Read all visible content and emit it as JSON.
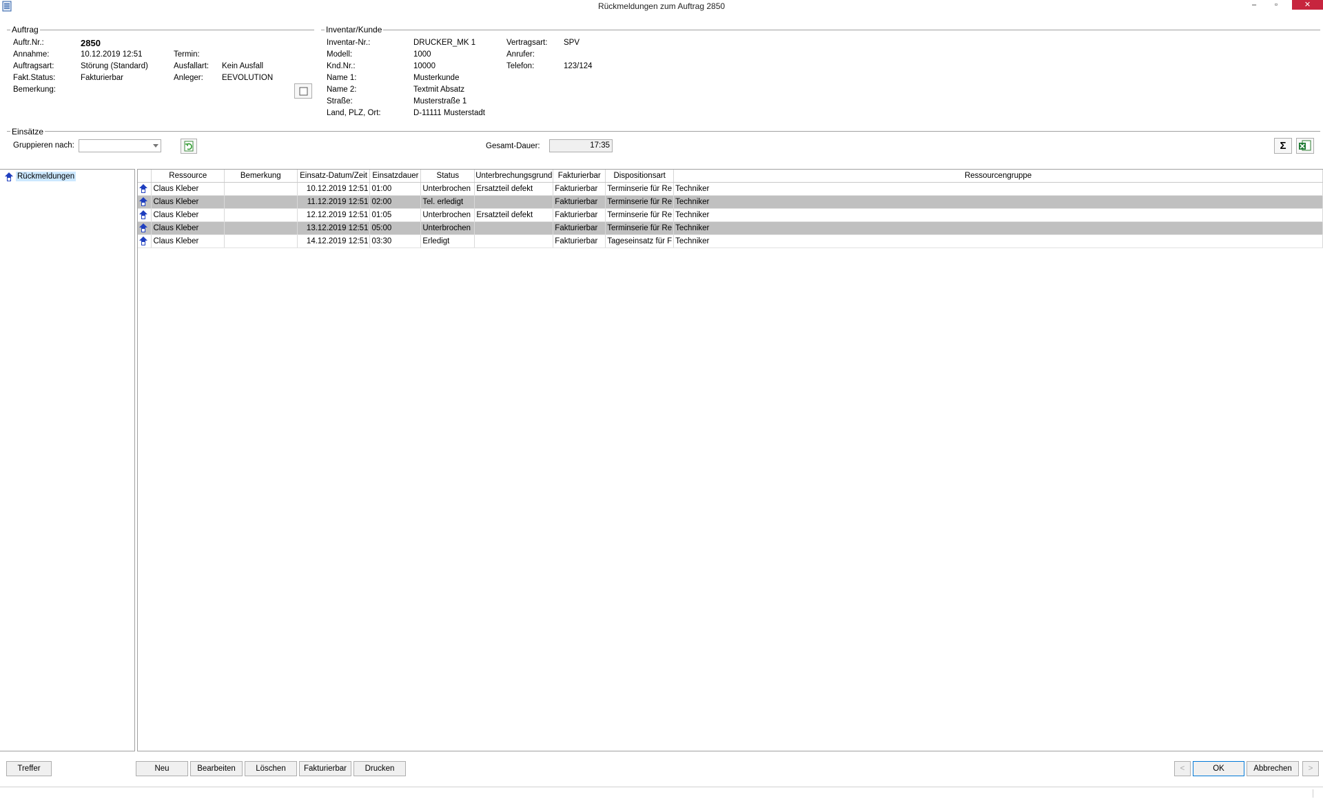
{
  "window": {
    "title": "Rückmeldungen zum Auftrag 2850",
    "min": "–",
    "max": "▫",
    "close": "✕"
  },
  "auftrag": {
    "title": "Auftrag",
    "auftr_nr_label": "Auftr.Nr.:",
    "auftr_nr": "2850",
    "annahme_label": "Annahme:",
    "annahme": "10.12.2019 12:51",
    "auftragsart_label": "Auftragsart:",
    "auftragsart": "Störung (Standard)",
    "fakt_status_label": "Fakt.Status:",
    "fakt_status": "Fakturierbar",
    "bemerkung_label": "Bemerkung:",
    "termin_label": "Termin:",
    "ausfallart_label": "Ausfallart:",
    "ausfallart": "Kein Ausfall",
    "anleger_label": "Anleger:",
    "anleger": "EEVOLUTION"
  },
  "inventar": {
    "title": "Inventar/Kunde",
    "inventar_nr_label": "Inventar-Nr.:",
    "inventar_nr": "DRUCKER_MK 1",
    "modell_label": "Modell:",
    "modell": "1000",
    "knd_nr_label": "Knd.Nr.:",
    "knd_nr": "10000",
    "name1_label": "Name 1:",
    "name1": "Musterkunde",
    "name2_label": "Name 2:",
    "name2": "Textmit Absatz",
    "strasse_label": "Straße:",
    "strasse": "Musterstraße 1",
    "land_label": "Land, PLZ, Ort:",
    "land": "D-11111 Musterstadt",
    "vertragsart_label": "Vertragsart:",
    "vertragsart": "SPV",
    "anrufer_label": "Anrufer:",
    "telefon_label": "Telefon:",
    "telefon": "123/124"
  },
  "einsaetze": {
    "title": "Einsätze",
    "gruppieren_label": "Gruppieren nach:",
    "gruppieren_value": "",
    "gesamt_label": "Gesamt-Dauer:",
    "gesamt_value": "17:35"
  },
  "tree": {
    "root": "Rückmeldungen"
  },
  "grid": {
    "columns": [
      "Ressource",
      "Bemerkung",
      "Einsatz-Datum/Zeit",
      "Einsatzdauer",
      "Status",
      "Unterbrechungsgrund",
      "Fakturierbar",
      "Dispositionsart",
      "Ressourcengruppe"
    ],
    "rows": [
      {
        "ressource": "Claus Kleber",
        "bemerkung": "",
        "datum": "10.12.2019 12:51",
        "dauer": "01:00",
        "status": "Unterbrochen",
        "grund": "Ersatzteil defekt",
        "fakt": "Fakturierbar",
        "dispo": "Terminserie für Re",
        "gruppe": "Techniker"
      },
      {
        "ressource": "Claus Kleber",
        "bemerkung": "",
        "datum": "11.12.2019 12:51",
        "dauer": "02:00",
        "status": "Tel. erledigt",
        "grund": "",
        "fakt": "Fakturierbar",
        "dispo": "Terminserie für Re",
        "gruppe": "Techniker"
      },
      {
        "ressource": "Claus Kleber",
        "bemerkung": "",
        "datum": "12.12.2019 12:51",
        "dauer": "01:05",
        "status": "Unterbrochen",
        "grund": "Ersatzteil defekt",
        "fakt": "Fakturierbar",
        "dispo": "Terminserie für Re",
        "gruppe": "Techniker"
      },
      {
        "ressource": "Claus Kleber",
        "bemerkung": "",
        "datum": "13.12.2019 12:51",
        "dauer": "05:00",
        "status": "Unterbrochen",
        "grund": "",
        "fakt": "Fakturierbar",
        "dispo": "Terminserie für Re",
        "gruppe": "Techniker"
      },
      {
        "ressource": "Claus Kleber",
        "bemerkung": "",
        "datum": "14.12.2019 12:51",
        "dauer": "03:30",
        "status": "Erledigt",
        "grund": "",
        "fakt": "Fakturierbar",
        "dispo": "Tageseinsatz für F",
        "gruppe": "Techniker"
      }
    ]
  },
  "buttons": {
    "treffer": "Treffer",
    "neu": "Neu",
    "bearbeiten": "Bearbeiten",
    "loeschen": "Löschen",
    "fakturierbar": "Fakturierbar",
    "drucken": "Drucken",
    "prev": "<",
    "ok": "OK",
    "abbrechen": "Abbrechen",
    "next": ">",
    "sigma": "Σ"
  },
  "colors": {
    "close": "#c7253e",
    "row_alt": "#c0c0c0",
    "tree_selected": "#cce8ff",
    "icon_blue": "#1f3fbf"
  }
}
